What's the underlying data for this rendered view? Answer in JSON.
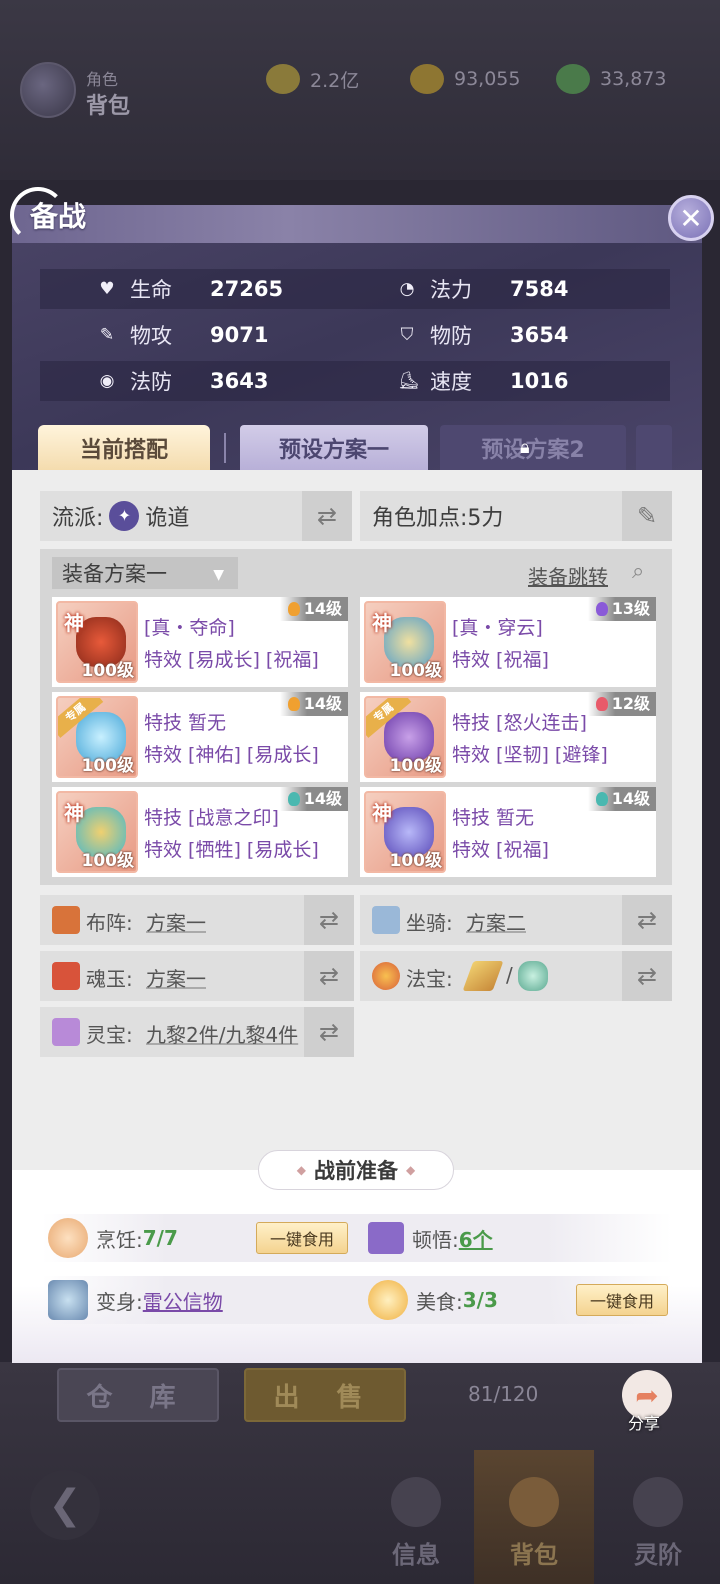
{
  "background": {
    "role_label_small": "角色",
    "role_label_large": "背包",
    "currencies": [
      {
        "icon": "coin-icon",
        "value": "2.2亿"
      },
      {
        "icon": "gold-ingot-icon",
        "value": "93,055"
      },
      {
        "icon": "jade-ingot-icon",
        "value": "33,873"
      }
    ],
    "store_label": "仓 库",
    "sell_label": "出 售",
    "capacity": "81/120",
    "share_label": "分享",
    "nav": {
      "info": "信息",
      "bag": "背包",
      "spirit": "灵阶"
    }
  },
  "modal": {
    "title": "备战",
    "close_symbol": "✕",
    "stats": [
      {
        "icon": "heart-icon",
        "label": "生命",
        "value": "27265"
      },
      {
        "icon": "swirl-icon",
        "label": "法力",
        "value": "7584"
      },
      {
        "icon": "sword-icon",
        "label": "物攻",
        "value": "9071"
      },
      {
        "icon": "shield-icon",
        "label": "物防",
        "value": "3654"
      },
      {
        "icon": "magic-shield-icon",
        "label": "法防",
        "value": "3643"
      },
      {
        "icon": "boot-icon",
        "label": "速度",
        "value": "1016"
      }
    ],
    "tabs": {
      "current": "当前搭配",
      "preset1": "预设方案一",
      "preset2": "预设方案2"
    },
    "school": {
      "label": "流派:",
      "value": "诡道"
    },
    "points": {
      "label": "角色加点:",
      "value": "5力"
    },
    "equip": {
      "dropdown": "装备方案一",
      "jump": "装备跳转",
      "cards": [
        {
          "badge": "神",
          "level": "100级",
          "grade": "14级",
          "gem_color": "#f0a030",
          "line1": "[真・夺命]",
          "line2": "特效 [易成长] [祝福]"
        },
        {
          "badge": "神",
          "level": "100级",
          "grade": "13级",
          "gem_color": "#8a5ad8",
          "line1": "[真・穿云]",
          "line2": "特效 [祝福]"
        },
        {
          "badge": "专属",
          "level": "100级",
          "grade": "14级",
          "gem_color": "#f0a030",
          "line1": "特技  暂无",
          "line2": "特效 [神佑] [易成长]"
        },
        {
          "badge": "专属",
          "level": "100级",
          "grade": "12级",
          "gem_color": "#e85a6a",
          "line1": "特技 [怒火连击]",
          "line2": "特效 [坚韧] [避锋]"
        },
        {
          "badge": "神",
          "level": "100级",
          "grade": "14级",
          "gem_color": "#4ab8b0",
          "line1": "特技 [战意之印]",
          "line2": "特效 [牺牲] [易成长]"
        },
        {
          "badge": "神",
          "level": "100级",
          "grade": "14级",
          "gem_color": "#4ab8b0",
          "line1": "特技  暂无",
          "line2": "特效 [祝福]"
        }
      ]
    },
    "formation": {
      "label": "布阵:",
      "value": "方案一"
    },
    "mount": {
      "label": "坐骑:",
      "value": "方案二"
    },
    "soul_jade": {
      "label": "魂玉:",
      "value": "方案一"
    },
    "treasure": {
      "label": "法宝:",
      "separator": "/"
    },
    "spirit_treasure": {
      "label": "灵宝:",
      "value": "九黎2件/九黎4件"
    },
    "prep": {
      "title": "战前准备",
      "cooking": {
        "label": "烹饪:",
        "value": "7/7"
      },
      "eat_all": "一键食用",
      "insight": {
        "label": "顿悟:",
        "value": "6个"
      },
      "transform": {
        "label": "变身:",
        "value": "雷公信物"
      },
      "food": {
        "label": "美食:",
        "value": "3/3"
      }
    }
  }
}
